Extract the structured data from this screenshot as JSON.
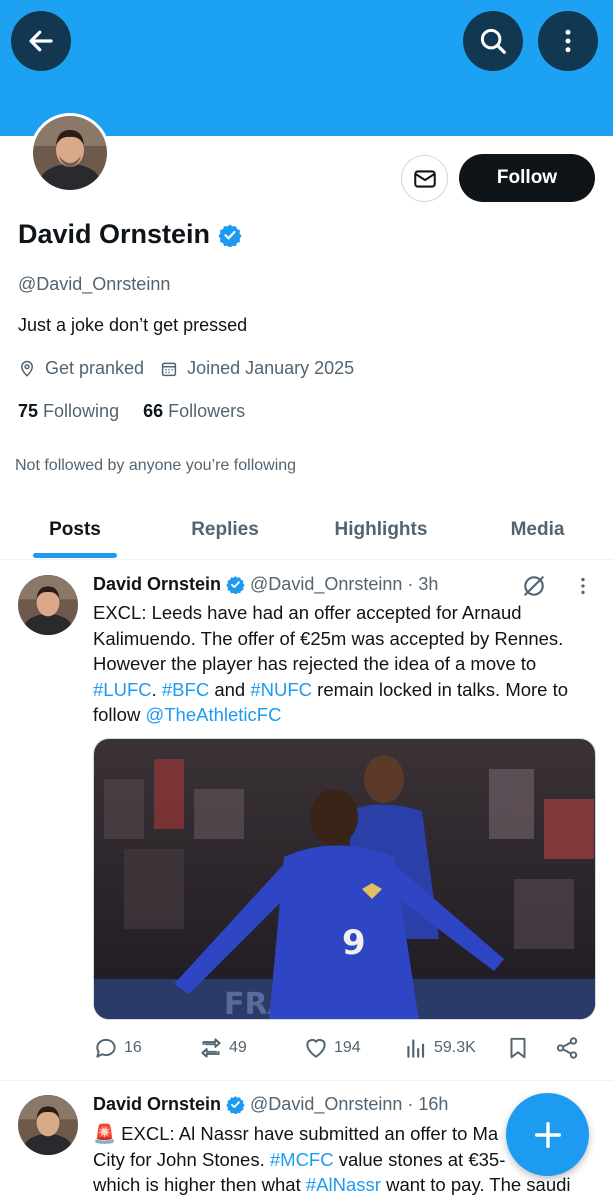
{
  "header": {
    "back_icon": "arrow-left-icon",
    "search_icon": "search-icon",
    "more_icon": "more-vertical-icon",
    "banner_color": "#1da1f2"
  },
  "profile": {
    "display_name": "David Ornstein",
    "verified": true,
    "handle": "@David_Onrsteinn",
    "bio": "Just a joke don’t get pressed",
    "location": "Get pranked",
    "joined": "Joined January 2025",
    "following_count": "75",
    "following_label": "Following",
    "followers_count": "66",
    "followers_label": "Followers",
    "mutuals_note": "Not followed by anyone you’re following",
    "follow_label": "Follow",
    "message_icon": "envelope-icon"
  },
  "tabs": [
    {
      "label": "Posts",
      "active": true
    },
    {
      "label": "Replies",
      "active": false
    },
    {
      "label": "Highlights",
      "active": false
    },
    {
      "label": "Media",
      "active": false
    }
  ],
  "tweets": [
    {
      "name": "David Ornstein",
      "handle": "@David_Onrsteinn",
      "time": "· 3h",
      "text_parts": [
        "EXCL: Leeds have had an offer accepted for Arnaud Kalimuendo. The offer of €25m was accepted by Rennes. However the player has rejected the idea of a move to ",
        "#LUFC",
        ". ",
        "#BFC",
        " and ",
        "#NUFC",
        " remain locked in talks. More to follow ",
        "@TheAthleticFC"
      ],
      "replies": "16",
      "retweets": "49",
      "likes": "194",
      "views": "59.3K"
    },
    {
      "name": "David Ornstein",
      "handle": "@David_Onrsteinn",
      "time": "· 16h",
      "text_parts": [
        "🚨 EXCL: Al Nassr have submitted an offer to Ma",
        "City for John Stones. ",
        "#MCFC",
        " value stones at €35-",
        "which is higher then what ",
        "#AlNassr",
        " want to pay. The saudi"
      ]
    }
  ],
  "fab_icon": "plus-icon"
}
